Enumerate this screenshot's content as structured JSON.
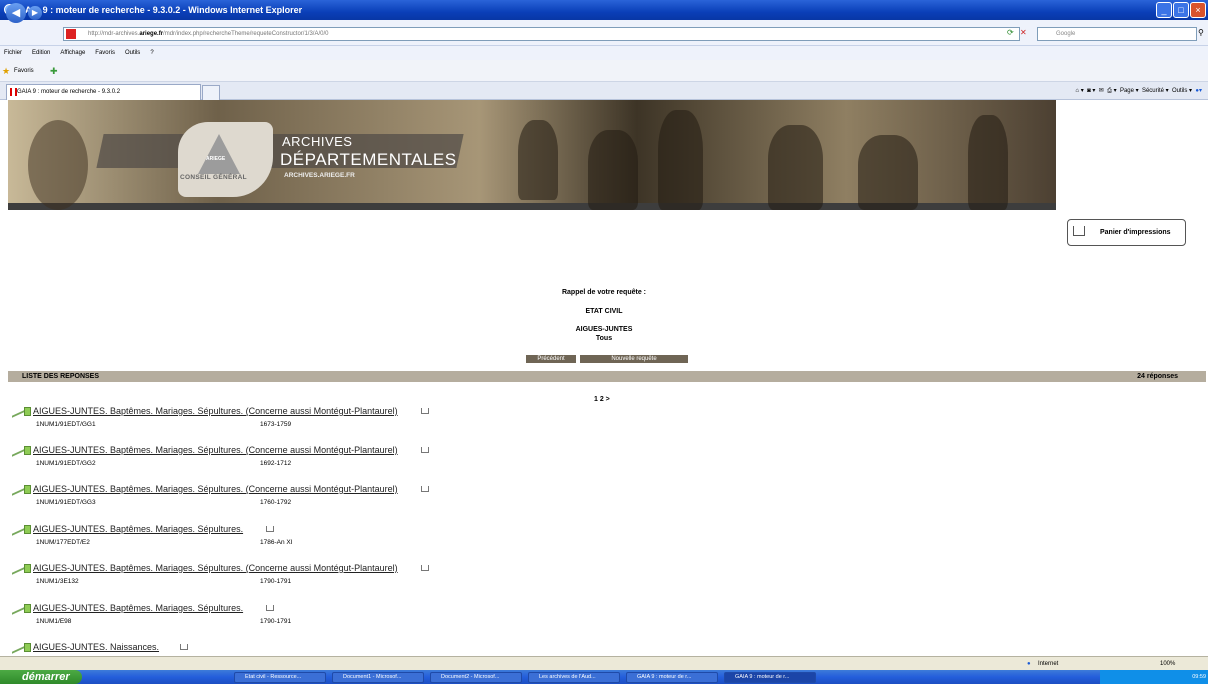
{
  "window": {
    "title": "GAIA 9 : moteur de recherche - 9.3.0.2 - Windows Internet Explorer"
  },
  "address": {
    "url_prefix": "http://mdr-archives.",
    "url_domain": "ariege.fr",
    "url_path": "/mdr/index.php/rechercheTheme/requeteConstructor/1/3/A/0/0",
    "search_placeholder": "Google"
  },
  "menu": [
    "Fichier",
    "Edition",
    "Affichage",
    "Favoris",
    "Outils",
    "?"
  ],
  "favorites": {
    "label": "Favoris"
  },
  "tab": {
    "title": "GAIA 9 : moteur de recherche - 9.3.0.2"
  },
  "toolbar": {
    "page": "Page",
    "securite": "Sécurité",
    "outils": "Outils"
  },
  "banner": {
    "archives": "ARCHIVES",
    "departementales": "DÉPARTEMENTALES",
    "url": "ARCHIVES.ARIEGE.FR",
    "conseil": "CONSEIL GÉNÉRAL",
    "ariege": "ARIEGE"
  },
  "panier": {
    "label": "Panier d'impressions"
  },
  "rappel": {
    "heading": "Rappel de votre requête :",
    "domain": "ETAT CIVIL",
    "commune": "AIGUES-JUNTES",
    "scope": "Tous"
  },
  "buttons": {
    "previous": "Précédent",
    "new_query": "Nouvelle requête"
  },
  "list": {
    "header": "LISTE DES REPONSES",
    "count": "24 réponses",
    "pager": "1 2 >"
  },
  "results": [
    {
      "title": "AIGUES-JUNTES. Baptêmes. Mariages. Sépultures. (Concerne aussi Montégut-Plantaurel)",
      "cote": "1NUM1/91EDT/GG1",
      "dates": "1673-1759"
    },
    {
      "title": "AIGUES-JUNTES. Baptêmes. Mariages. Sépultures. (Concerne aussi Montégut-Plantaurel)",
      "cote": "1NUM1/91EDT/GG2",
      "dates": "1692-1712"
    },
    {
      "title": "AIGUES-JUNTES. Baptêmes. Mariages. Sépultures. (Concerne aussi Montégut-Plantaurel)",
      "cote": "1NUM1/91EDT/GG3",
      "dates": "1760-1792"
    },
    {
      "title": "AIGUES-JUNTES. Baptêmes. Mariages. Sépultures.",
      "cote": "1NUM/177EDT/E2",
      "dates": "1786-An XI"
    },
    {
      "title": "AIGUES-JUNTES. Baptêmes. Mariages. Sépultures. (Concerne aussi Montégut-Plantaurel)",
      "cote": "1NUM1/3E132",
      "dates": "1790-1791"
    },
    {
      "title": "AIGUES-JUNTES. Baptêmes. Mariages. Sépultures.",
      "cote": "1NUM1/E98",
      "dates": "1790-1791"
    },
    {
      "title": "AIGUES-JUNTES. Naissances.",
      "cote": "",
      "dates": ""
    }
  ],
  "status": {
    "zone": "Internet",
    "zoom": "100%"
  },
  "taskbar": {
    "start": "démarrer",
    "tasks": [
      "Etat civil - Ressource...",
      "Document1 - Microsof...",
      "Document2 - Microsof...",
      "Les archives de l'Aud...",
      "GAIA 9 : moteur de r...",
      "GAIA 9 : moteur de r..."
    ],
    "clock": "09:59"
  }
}
